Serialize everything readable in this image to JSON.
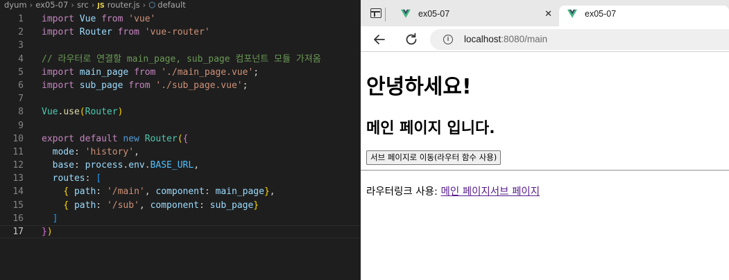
{
  "editor": {
    "breadcrumb": [
      "dyum",
      "ex05-07",
      "src",
      "router.js",
      "default"
    ],
    "breadcrumb_js_badge": "JS",
    "active_line": 17,
    "lines": [
      {
        "n": "1",
        "tokens": [
          [
            "kw",
            "import"
          ],
          [
            "pl",
            " "
          ],
          [
            "id",
            "Vue"
          ],
          [
            "pl",
            " "
          ],
          [
            "kw",
            "from"
          ],
          [
            "pl",
            " "
          ],
          [
            "str",
            "'vue'"
          ]
        ]
      },
      {
        "n": "2",
        "tokens": [
          [
            "kw",
            "import"
          ],
          [
            "pl",
            " "
          ],
          [
            "id",
            "Router"
          ],
          [
            "pl",
            " "
          ],
          [
            "kw",
            "from"
          ],
          [
            "pl",
            " "
          ],
          [
            "str",
            "'vue-router'"
          ]
        ]
      },
      {
        "n": "3",
        "tokens": []
      },
      {
        "n": "4",
        "tokens": [
          [
            "cmt",
            "// 라우터로 연결할 main_page, sub_page 컴포넌트 모듈 가져옴"
          ]
        ]
      },
      {
        "n": "5",
        "tokens": [
          [
            "kw",
            "import"
          ],
          [
            "pl",
            " "
          ],
          [
            "id",
            "main_page"
          ],
          [
            "pl",
            " "
          ],
          [
            "kw",
            "from"
          ],
          [
            "pl",
            " "
          ],
          [
            "str",
            "'./main_page.vue'"
          ],
          [
            "pl",
            ";"
          ]
        ]
      },
      {
        "n": "6",
        "tokens": [
          [
            "kw",
            "import"
          ],
          [
            "pl",
            " "
          ],
          [
            "id",
            "sub_page"
          ],
          [
            "pl",
            " "
          ],
          [
            "kw",
            "from"
          ],
          [
            "pl",
            " "
          ],
          [
            "str",
            "'./sub_page.vue'"
          ],
          [
            "pl",
            ";"
          ]
        ]
      },
      {
        "n": "7",
        "tokens": []
      },
      {
        "n": "8",
        "tokens": [
          [
            "cls",
            "Vue"
          ],
          [
            "pl",
            "."
          ],
          [
            "fn",
            "use"
          ],
          [
            "b1",
            "("
          ],
          [
            "cls",
            "Router"
          ],
          [
            "b1",
            ")"
          ]
        ]
      },
      {
        "n": "9",
        "tokens": []
      },
      {
        "n": "10",
        "tokens": [
          [
            "kw",
            "export"
          ],
          [
            "pl",
            " "
          ],
          [
            "kw",
            "default"
          ],
          [
            "pl",
            " "
          ],
          [
            "dkw",
            "new"
          ],
          [
            "pl",
            " "
          ],
          [
            "cls",
            "Router"
          ],
          [
            "b1",
            "("
          ],
          [
            "b2",
            "{"
          ]
        ]
      },
      {
        "n": "11",
        "tokens": [
          [
            "pl",
            "  "
          ],
          [
            "prop",
            "mode"
          ],
          [
            "pl",
            ": "
          ],
          [
            "str",
            "'history'"
          ],
          [
            "pl",
            ","
          ]
        ]
      },
      {
        "n": "12",
        "tokens": [
          [
            "pl",
            "  "
          ],
          [
            "prop",
            "base"
          ],
          [
            "pl",
            ": "
          ],
          [
            "id",
            "process"
          ],
          [
            "pl",
            "."
          ],
          [
            "id",
            "env"
          ],
          [
            "pl",
            "."
          ],
          [
            "const",
            "BASE_URL"
          ],
          [
            "pl",
            ","
          ]
        ]
      },
      {
        "n": "13",
        "tokens": [
          [
            "pl",
            "  "
          ],
          [
            "prop",
            "routes"
          ],
          [
            "pl",
            ": "
          ],
          [
            "b3",
            "["
          ]
        ]
      },
      {
        "n": "14",
        "tokens": [
          [
            "pl",
            "    "
          ],
          [
            "b1",
            "{"
          ],
          [
            "pl",
            " "
          ],
          [
            "prop",
            "path"
          ],
          [
            "pl",
            ": "
          ],
          [
            "str",
            "'/main'"
          ],
          [
            "pl",
            ", "
          ],
          [
            "prop",
            "component"
          ],
          [
            "pl",
            ": "
          ],
          [
            "id",
            "main_page"
          ],
          [
            "b1",
            "}"
          ],
          [
            "pl",
            ","
          ]
        ]
      },
      {
        "n": "15",
        "tokens": [
          [
            "pl",
            "    "
          ],
          [
            "b1",
            "{"
          ],
          [
            "pl",
            " "
          ],
          [
            "prop",
            "path"
          ],
          [
            "pl",
            ": "
          ],
          [
            "str",
            "'/sub'"
          ],
          [
            "pl",
            ", "
          ],
          [
            "prop",
            "component"
          ],
          [
            "pl",
            ": "
          ],
          [
            "id",
            "sub_page"
          ],
          [
            "b1",
            "}"
          ]
        ]
      },
      {
        "n": "16",
        "tokens": [
          [
            "pl",
            "  "
          ],
          [
            "b3",
            "]"
          ]
        ]
      },
      {
        "n": "17",
        "tokens": [
          [
            "b2",
            "}"
          ],
          [
            "b1",
            ")"
          ]
        ]
      }
    ]
  },
  "browser": {
    "tabs": [
      {
        "title": "ex05-07",
        "close": "✕",
        "active": false
      },
      {
        "title": "ex05-07",
        "close": "✕",
        "active": true
      }
    ],
    "address": {
      "host": "localhost",
      "rest": ":8080/main"
    },
    "page": {
      "h1": "안녕하세요!",
      "h2": "메인 페이지 입니다.",
      "button_label": "서브 페이지로 이동(라우터 함수 사용)",
      "router_link_prefix": "라우터링크 사용: ",
      "link_main": "메인 페이지",
      "link_sub": "서브 페이지"
    }
  },
  "colors": {
    "editor_bg": "#1e1e1e",
    "visited_link": "#551a8b",
    "vue_green": "#41b883",
    "vue_dark": "#35495e"
  }
}
